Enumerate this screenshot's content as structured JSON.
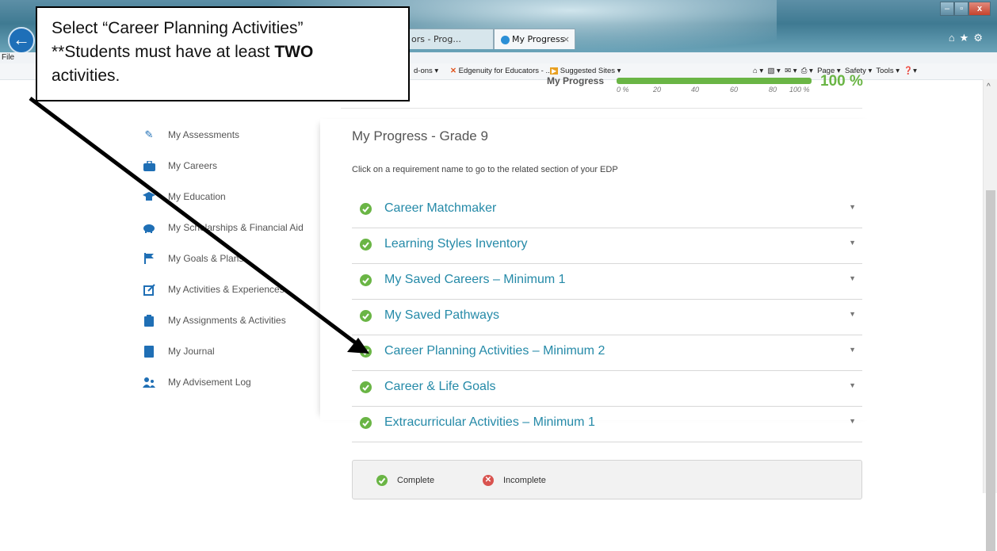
{
  "browser": {
    "file_menu": "File",
    "tabs": [
      {
        "label": "ors - Prog...",
        "active": false
      },
      {
        "label": "My Progress",
        "active": true
      }
    ],
    "window_controls": [
      "–",
      "▫",
      "x"
    ],
    "favorites": {
      "addons": "d-ons ▾",
      "edgenuity": "Edgenuity for Educators - ...",
      "suggested": "Suggested Sites ▾"
    },
    "commands": [
      "Page ▾",
      "Safety ▾",
      "Tools ▾"
    ]
  },
  "callout": {
    "line1": "Select “Career Planning Activities”",
    "line2_prefix": "**Students must have at least ",
    "line2_bold": "TWO",
    "line3": "activities."
  },
  "progress": {
    "label": "My Progress",
    "value_text": "100 %",
    "fraction": 1.0,
    "scale": [
      "0 %",
      "20",
      "40",
      "60",
      "80",
      "100 %"
    ]
  },
  "sidebar": {
    "items": [
      {
        "label": "My Assessments",
        "icon": "pencil-icon"
      },
      {
        "label": "My Careers",
        "icon": "briefcase-icon"
      },
      {
        "label": "My Education",
        "icon": "graduation-cap-icon"
      },
      {
        "label": "My Scholarships & Financial Aid",
        "icon": "piggy-bank-icon"
      },
      {
        "label": "My Goals & Plans",
        "icon": "flag-icon"
      },
      {
        "label": "My Activities & Experiences",
        "icon": "edit-square-icon"
      },
      {
        "label": "My Assignments & Activities",
        "icon": "clipboard-icon"
      },
      {
        "label": "My Journal",
        "icon": "book-icon"
      },
      {
        "label": "My Advisement Log",
        "icon": "users-icon"
      }
    ]
  },
  "main": {
    "title": "My Progress - Grade 9",
    "instructions": "Click on a requirement name to go to the related section of your EDP",
    "requirements": [
      {
        "label": "Career Matchmaker",
        "status": "complete"
      },
      {
        "label": "Learning Styles Inventory",
        "status": "complete"
      },
      {
        "label": "My Saved Careers – Minimum 1",
        "status": "complete"
      },
      {
        "label": "My Saved Pathways",
        "status": "complete"
      },
      {
        "label": "Career Planning Activities – Minimum 2",
        "status": "complete"
      },
      {
        "label": "Career & Life Goals",
        "status": "complete"
      },
      {
        "label": "Extracurricular Activities – Minimum 1",
        "status": "complete"
      }
    ]
  },
  "legend": {
    "complete": "Complete",
    "incomplete": "Incomplete"
  },
  "colors": {
    "accent_link": "#258aa8",
    "complete_green": "#6ab545",
    "incomplete_red": "#d9534f",
    "icon_blue": "#1f6fb5"
  }
}
